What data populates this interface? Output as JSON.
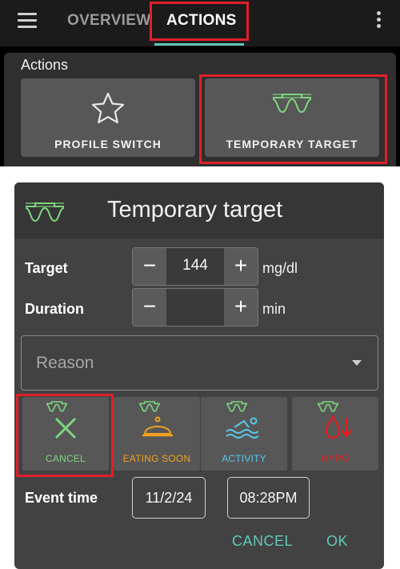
{
  "topbar": {
    "tabs": [
      {
        "label": "OVERVIEW"
      },
      {
        "label": "ACTIONS"
      }
    ]
  },
  "actions_panel": {
    "title": "Actions",
    "tiles": [
      {
        "label": "PROFILE SWITCH",
        "icon": "star-icon"
      },
      {
        "label": "TEMPORARY TARGET",
        "icon": "temp-target-icon"
      }
    ]
  },
  "dialog": {
    "title": "Temporary target",
    "target": {
      "label": "Target",
      "value": "144",
      "unit": "mg/dl"
    },
    "duration": {
      "label": "Duration",
      "value": "",
      "unit": "min"
    },
    "reason": {
      "placeholder": "Reason"
    },
    "presets": [
      {
        "label": "CANCEL",
        "icon": "cancel-x-icon",
        "color": "#7ed67e"
      },
      {
        "label": "EATING SOON",
        "icon": "food-cloche-icon",
        "color": "#f0a020"
      },
      {
        "label": "ACTIVITY",
        "icon": "swimmer-icon",
        "color": "#58c8e8"
      },
      {
        "label": "HYPO",
        "icon": "blood-drop-down-icon",
        "color": "#e41c1c"
      }
    ],
    "event_time": {
      "label": "Event time",
      "date": "11/2/24",
      "time": "08:28PM"
    },
    "buttons": {
      "cancel": "CANCEL",
      "ok": "OK"
    }
  },
  "colors": {
    "accent": "#61c9b8",
    "highlight": "#e0202a",
    "icon_green": "#7ed67e"
  }
}
